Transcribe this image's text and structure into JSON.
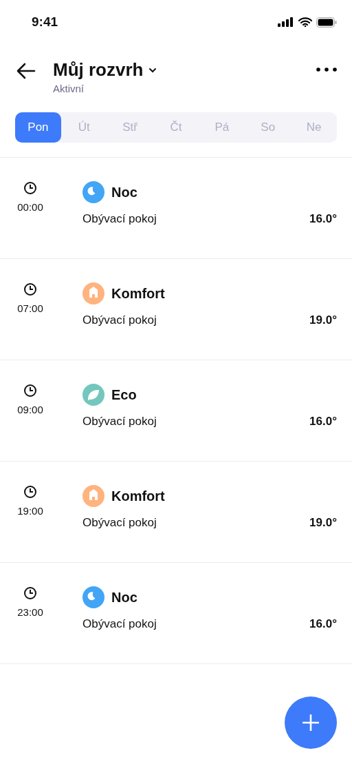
{
  "status_bar": {
    "time": "9:41"
  },
  "header": {
    "title": "Můj rozvrh",
    "subtitle": "Aktivní"
  },
  "day_tabs": [
    {
      "label": "Pon",
      "selected": true
    },
    {
      "label": "Út",
      "selected": false
    },
    {
      "label": "Stř",
      "selected": false
    },
    {
      "label": "Čt",
      "selected": false
    },
    {
      "label": "Pá",
      "selected": false
    },
    {
      "label": "So",
      "selected": false
    },
    {
      "label": "Ne",
      "selected": false
    }
  ],
  "schedule": [
    {
      "time": "00:00",
      "kind": "night",
      "mode": "Noc",
      "color": "#42a5f5",
      "room": "Obývací pokoj",
      "temperature": "16.0°"
    },
    {
      "time": "07:00",
      "kind": "comfort",
      "mode": "Komfort",
      "color": "#ffb37e",
      "room": "Obývací pokoj",
      "temperature": "19.0°"
    },
    {
      "time": "09:00",
      "kind": "eco",
      "mode": "Eco",
      "color": "#73c7bd",
      "room": "Obývací pokoj",
      "temperature": "16.0°"
    },
    {
      "time": "19:00",
      "kind": "comfort",
      "mode": "Komfort",
      "color": "#ffb37e",
      "room": "Obývací pokoj",
      "temperature": "19.0°"
    },
    {
      "time": "23:00",
      "kind": "night",
      "mode": "Noc",
      "color": "#42a5f5",
      "room": "Obývací pokoj",
      "temperature": "16.0°"
    }
  ]
}
